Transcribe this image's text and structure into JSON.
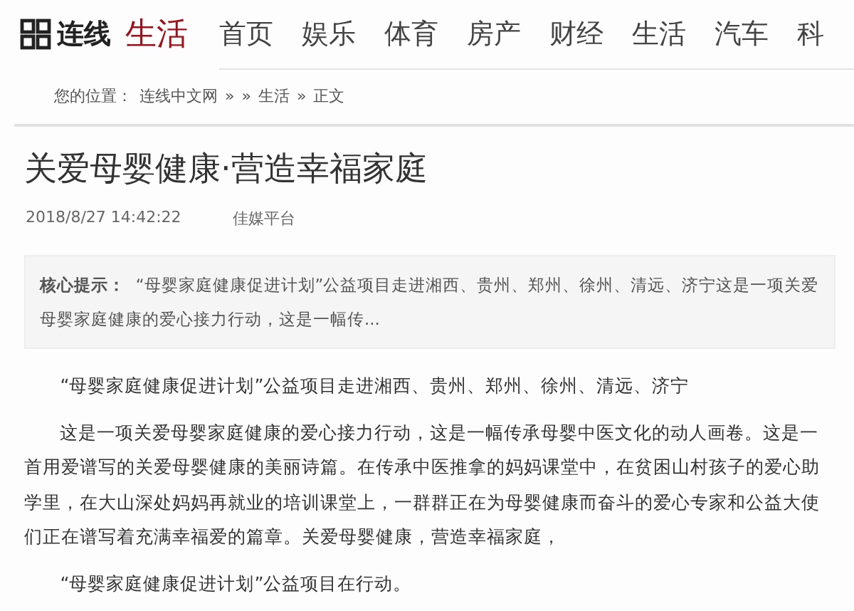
{
  "header": {
    "logo_text": "连线",
    "section": "生活",
    "nav": [
      {
        "label": "首页"
      },
      {
        "label": "娱乐"
      },
      {
        "label": "体育"
      },
      {
        "label": "房产"
      },
      {
        "label": "财经"
      },
      {
        "label": "生活"
      },
      {
        "label": "汽车"
      },
      {
        "label": "科"
      }
    ]
  },
  "breadcrumb": {
    "prefix": "您的位置：",
    "items": [
      "连线中文网",
      "»",
      "»",
      "生活",
      "»",
      "正文"
    ]
  },
  "article": {
    "title": "关爱母婴健康·营造幸福家庭",
    "date": "2018/8/27 14:42:22",
    "source": "佳媒平台",
    "summary": {
      "label": "核心提示：",
      "text": "“母婴家庭健康促进计划”公益项目走进湘西、贵州、郑州、徐州、清远、济宁这是一项关爱母婴家庭健康的爱心接力行动，这是一幅传..."
    },
    "paragraphs": [
      "“母婴家庭健康促进计划”公益项目走进湘西、贵州、郑州、徐州、清远、济宁",
      "这是一项关爱母婴家庭健康的爱心接力行动，这是一幅传承母婴中医文化的动人画卷。这是一首用爱谱写的关爱母婴健康的美丽诗篇。在传承中医推拿的妈妈课堂中，在贫困山村孩子的爱心助学里，在大山深处妈妈再就业的培训课堂上，一群群正在为母婴健康而奋斗的爱心专家和公益大使们正在谱写着充满幸福爱的篇章。关爱母婴健康，营造幸福家庭，",
      "“母婴家庭健康促进计划”公益项目在行动。"
    ]
  }
}
